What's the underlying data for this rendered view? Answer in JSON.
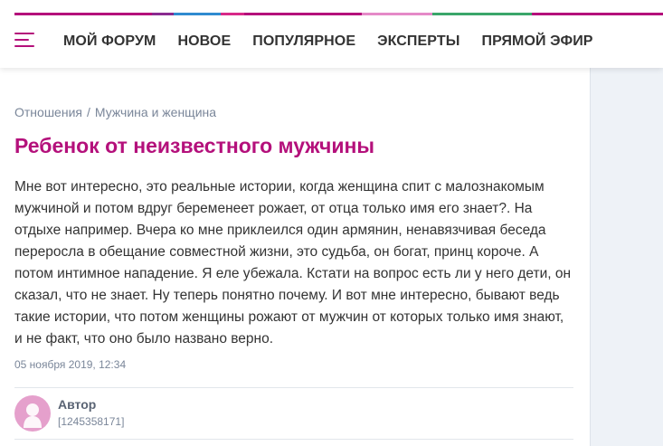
{
  "header": {
    "stripe_colors": [
      "#b4107b",
      "#8a2a8f",
      "#2f8bd0",
      "#d82888",
      "#b4107b",
      "#e58ac8",
      "#3aa66a",
      "#b4107b"
    ],
    "nav": [
      "МОЙ ФОРУМ",
      "НОВОЕ",
      "ПОПУЛЯРНОЕ",
      "ЭКСПЕРТЫ",
      "ПРЯМОЙ ЭФИР"
    ],
    "menu_icon": "hamburger-menu-icon"
  },
  "breadcrumb": {
    "items": [
      "Отношения",
      "Мужчина и женщина"
    ],
    "separator": "/"
  },
  "topic": {
    "title": "Ребенок от неизвестного мужчины",
    "body": "Мне вот интересно, это реальные истории, когда женщина спит с малознакомым мужчиной и потом вдруг беременеет рожает, от отца только имя его знает?. На отдыхе например. Вчера ко мне приклеился один армянин, ненавязчивая беседа переросла в обещание совместной жизни, это судьба, он богат, принц короче. А потом интимное нападение. Я еле убежала. Кстати на вопрос есть ли у него дети, он сказал, что не знает. Ну теперь понятно почему. И вот мне интересно, бывают ведь такие истории, что потом женщины рожают от мужчин от которых только имя знают, и не факт, что оно было названо верно.",
    "date": "05 ноября 2019, 12:34"
  },
  "author": {
    "label": "Автор",
    "id": "[1245358171]",
    "avatar_icon": "user-silhouette-icon"
  },
  "colors": {
    "accent": "#b4107b",
    "muted": "#7a8699",
    "sidebar_bg": "#eef2f7",
    "avatar_bg": "#e5a0cc"
  }
}
